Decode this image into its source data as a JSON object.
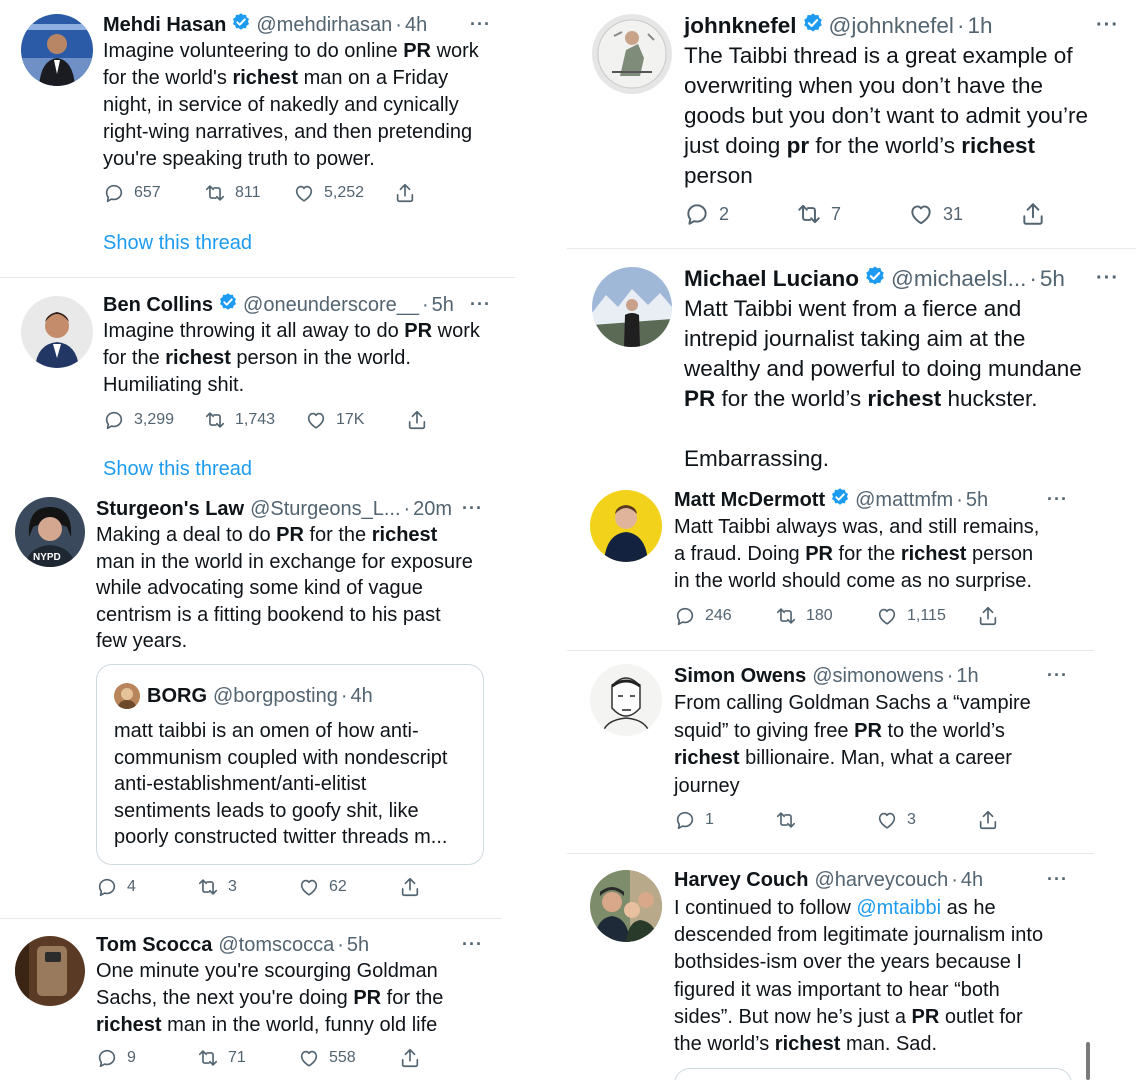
{
  "tweets": [
    {
      "name": "Mehdi Hasan",
      "handle": "@mehdirhasan",
      "time": "4h",
      "lines": [
        [
          {
            "t": "Imagine volunteering to do online "
          },
          {
            "t": "PR",
            "b": true
          },
          {
            "t": " work"
          }
        ],
        [
          {
            "t": "for the world's "
          },
          {
            "t": "richest",
            "b": true
          },
          {
            "t": " man on a Friday"
          }
        ],
        [
          {
            "t": "night, in service of nakedly and cynically"
          }
        ],
        [
          {
            "t": "right-wing narratives, and then pretending"
          }
        ],
        [
          {
            "t": "you're speaking truth to power."
          }
        ]
      ],
      "replies": "657",
      "retweets": "811",
      "likes": "5,252",
      "show_thread": "Show this thread"
    },
    {
      "name": "Ben Collins",
      "handle": "@oneunderscore__",
      "time": "5h",
      "lines": [
        [
          {
            "t": "Imagine throwing it all away to do "
          },
          {
            "t": "PR",
            "b": true
          },
          {
            "t": " work"
          }
        ],
        [
          {
            "t": "for the "
          },
          {
            "t": "richest",
            "b": true
          },
          {
            "t": " person in the world."
          }
        ],
        [
          {
            "t": "Humiliating shit."
          }
        ]
      ],
      "replies": "3,299",
      "retweets": "1,743",
      "likes": "17K",
      "show_thread": "Show this thread"
    },
    {
      "name": "Sturgeon's Law",
      "handle": "@Sturgeons_L...",
      "time": "20m",
      "lines": [
        [
          {
            "t": "Making a deal to do "
          },
          {
            "t": "PR",
            "b": true
          },
          {
            "t": " for the "
          },
          {
            "t": "richest",
            "b": true
          }
        ],
        [
          {
            "t": "man in the world in exchange for exposure"
          }
        ],
        [
          {
            "t": "while advocating some kind of vague"
          }
        ],
        [
          {
            "t": "centrism is a fitting bookend to his past"
          }
        ],
        [
          {
            "t": "few years."
          }
        ]
      ],
      "quote": {
        "name": "BORG",
        "handle": "@borgposting",
        "time": "4h",
        "lines": [
          "matt taibbi is an omen of how anti-",
          "communism coupled with nondescript",
          "anti-establishment/anti-elitist",
          "sentiments leads to goofy shit, like",
          "poorly constructed twitter threads m..."
        ]
      },
      "replies": "4",
      "retweets": "3",
      "likes": "62"
    },
    {
      "name": "Tom Scocca",
      "handle": "@tomscocca",
      "time": "5h",
      "lines": [
        [
          {
            "t": "One minute you're scourging Goldman"
          }
        ],
        [
          {
            "t": "Sachs, the next you're doing "
          },
          {
            "t": "PR",
            "b": true
          },
          {
            "t": " for the"
          }
        ],
        [
          {
            "t": "richest",
            "b": true
          },
          {
            "t": " man in the world, funny old life"
          }
        ]
      ],
      "replies": "9",
      "retweets": "71",
      "likes": "558"
    },
    {
      "name": "johnknefel",
      "handle": "@johnknefel",
      "time": "1h",
      "lines": [
        [
          {
            "t": "The Taibbi thread is a great example of"
          }
        ],
        [
          {
            "t": "overwriting when you don’t have the"
          }
        ],
        [
          {
            "t": "goods but you don’t want to admit you’re"
          }
        ],
        [
          {
            "t": "just doing "
          },
          {
            "t": "pr",
            "b": true
          },
          {
            "t": " for the world’s "
          },
          {
            "t": "richest",
            "b": true
          }
        ],
        [
          {
            "t": "person"
          }
        ]
      ],
      "replies": "2",
      "retweets": "7",
      "likes": "31"
    },
    {
      "name": "Michael Luciano",
      "handle": "@michaelsl...",
      "time": "5h",
      "lines": [
        [
          {
            "t": "Matt Taibbi went from a fierce and"
          }
        ],
        [
          {
            "t": "intrepid journalist taking aim at the"
          }
        ],
        [
          {
            "t": "wealthy and powerful to doing mundane"
          }
        ],
        [
          {
            "t": "PR",
            "b": true
          },
          {
            "t": " for the world’s "
          },
          {
            "t": "richest",
            "b": true
          },
          {
            "t": " huckster."
          }
        ],
        [
          {
            "t": ""
          }
        ],
        [
          {
            "t": "Embarrassing."
          }
        ]
      ]
    },
    {
      "name": "Matt McDermott",
      "handle": "@mattmfm",
      "time": "5h",
      "lines": [
        [
          {
            "t": "Matt Taibbi always was, and still remains,"
          }
        ],
        [
          {
            "t": "a fraud. Doing "
          },
          {
            "t": "PR",
            "b": true
          },
          {
            "t": " for the "
          },
          {
            "t": "richest",
            "b": true
          },
          {
            "t": " person"
          }
        ],
        [
          {
            "t": "in the world should come as no surprise."
          }
        ]
      ],
      "replies": "246",
      "retweets": "180",
      "likes": "1,115"
    },
    {
      "name": "Simon Owens",
      "handle": "@simonowens",
      "time": "1h",
      "lines": [
        [
          {
            "t": "From calling Goldman Sachs a “vampire"
          }
        ],
        [
          {
            "t": "squid” to giving free "
          },
          {
            "t": "PR",
            "b": true
          },
          {
            "t": " to the world’s"
          }
        ],
        [
          {
            "t": "richest",
            "b": true
          },
          {
            "t": " billionaire. Man, what a career"
          }
        ],
        [
          {
            "t": "journey"
          }
        ]
      ],
      "replies": "1",
      "retweets": "",
      "likes": "3"
    },
    {
      "name": "Harvey Couch",
      "handle": "@harveycouch",
      "time": "4h",
      "lines": [
        [
          {
            "t": "I continued to follow "
          },
          {
            "t": "@mtaibbi",
            "m": true
          },
          {
            "t": " as he"
          }
        ],
        [
          {
            "t": "descended from legitimate journalism into"
          }
        ],
        [
          {
            "t": "bothsides-ism over the years because I"
          }
        ],
        [
          {
            "t": "figured it was important to hear “both"
          }
        ],
        [
          {
            "t": "sides”. But now he’s just a "
          },
          {
            "t": "PR",
            "b": true
          },
          {
            "t": " outlet for"
          }
        ],
        [
          {
            "t": "the world’s "
          },
          {
            "t": "richest",
            "b": true
          },
          {
            "t": " man. Sad."
          }
        ]
      ]
    }
  ],
  "colors": {
    "accent": "#1d9bf0",
    "text": "#0f1419",
    "muted": "#536471",
    "border": "#e7e9ea"
  },
  "icons": [
    "verified-badge-icon",
    "more-icon",
    "reply-icon",
    "retweet-icon",
    "like-icon",
    "share-icon"
  ]
}
